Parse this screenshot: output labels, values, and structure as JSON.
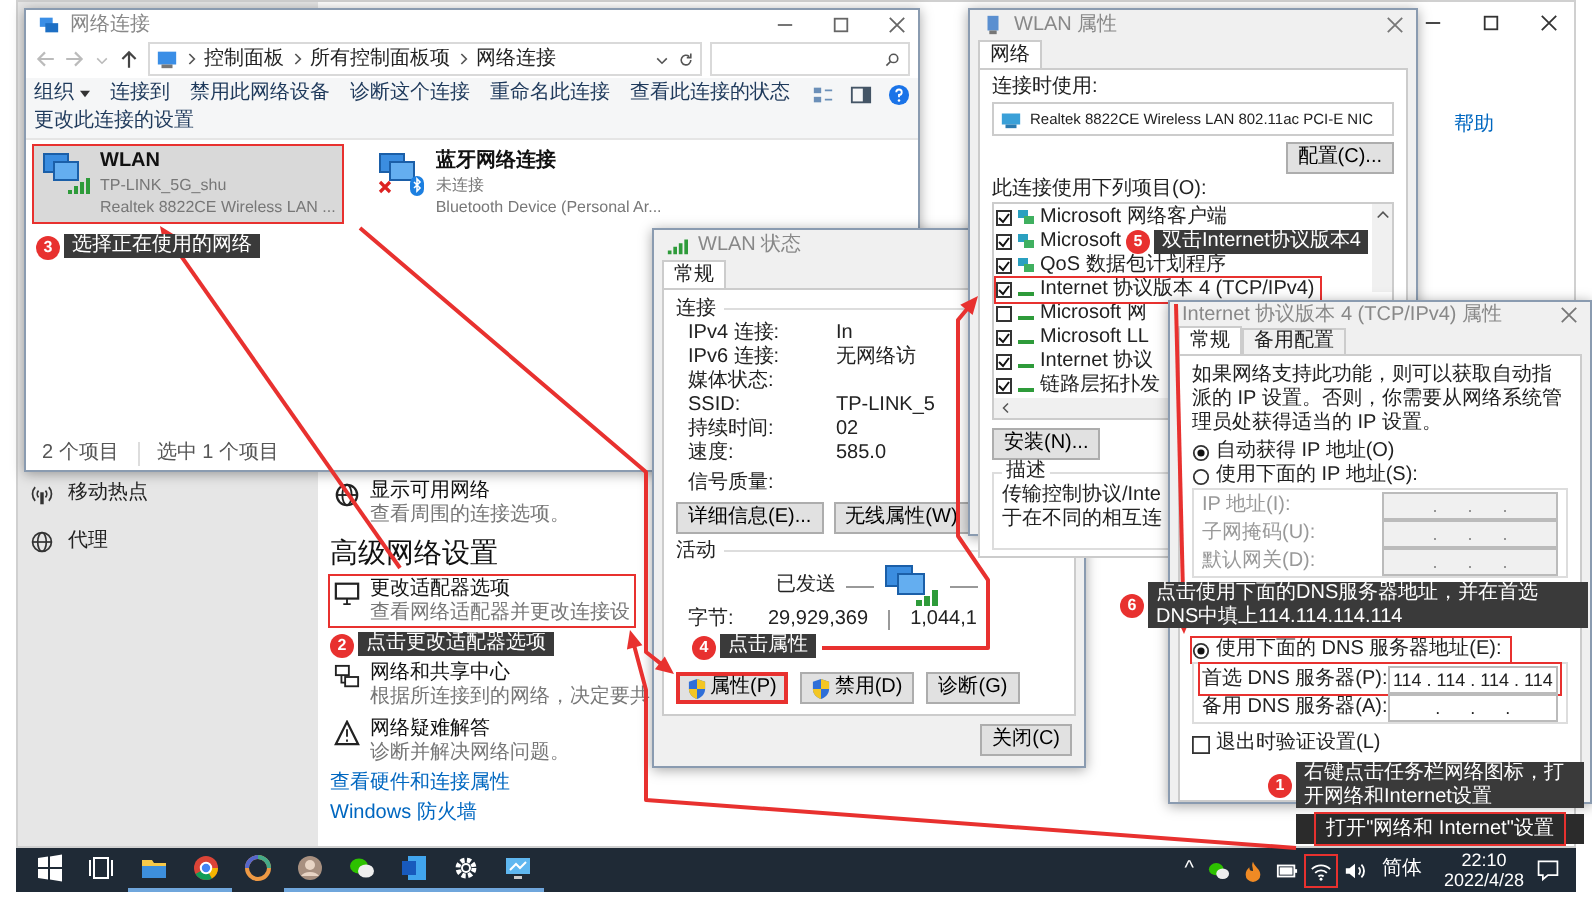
{
  "settings_window": {
    "help_link": "帮助",
    "nav": [
      {
        "label": "移动热点"
      },
      {
        "label": "代理"
      }
    ],
    "show_networks": {
      "title": "显示可用网络",
      "description": "查看周围的连接选项。"
    },
    "heading": "高级网络设置",
    "options": [
      {
        "title": "更改适配器选项",
        "description": "查看网络适配器并更改连接设",
        "highlighted": true
      },
      {
        "title": "网络和共享中心",
        "description": "根据所连接到的网络，决定要共",
        "highlighted": false
      },
      {
        "title": "网络疑难解答",
        "description": "诊断并解决网络问题。",
        "highlighted": false
      }
    ],
    "links": [
      "查看硬件和连接属性",
      "Windows 防火墙"
    ]
  },
  "explorer": {
    "title": "网络连接",
    "breadcrumb": [
      "控制面板",
      "所有控制面板项",
      "网络连接"
    ],
    "toolbar": [
      {
        "label": "组织",
        "menu": true
      },
      {
        "label": "连接到",
        "menu": false
      },
      {
        "label": "禁用此网络设备",
        "menu": false
      },
      {
        "label": "诊断这个连接",
        "menu": false
      },
      {
        "label": "重命名此连接",
        "menu": false
      },
      {
        "label": "查看此连接的状态",
        "menu": false
      },
      {
        "label": "更改此连接的设置",
        "menu": false
      }
    ],
    "connections": [
      {
        "name": "WLAN",
        "status": "TP-LINK_5G_shu",
        "device": "Realtek 8822CE Wireless LAN ...",
        "kind": "wifi",
        "selected": true,
        "highlighted": true
      },
      {
        "name": "蓝牙网络连接",
        "status": "未连接",
        "device": "Bluetooth Device (Personal Ar...",
        "kind": "bluetooth",
        "selected": false,
        "highlighted": false
      }
    ],
    "status_bar": [
      "2 个项目",
      "选中 1 个项目"
    ]
  },
  "status_window": {
    "title": "WLAN 状态",
    "tab": "常规",
    "connection_label": "连接",
    "rows": [
      {
        "label": "IPv4 连接:",
        "value": "In"
      },
      {
        "label": "IPv6 连接:",
        "value": "无网络访"
      },
      {
        "label": "媒体状态:"
      },
      {
        "label": "SSID:",
        "value": "TP-LINK_5"
      },
      {
        "label": "持续时间:",
        "value": "02"
      },
      {
        "label": "速度:",
        "value": "585.0"
      }
    ],
    "signal_label": "信号质量:",
    "detail_buttons": [
      "详细信息(E)...",
      "无线属性(W)"
    ],
    "activity_label": "活动",
    "sent_label": "已发送",
    "bytes_label": "字节:",
    "bytes_sent": "29,929,369",
    "bytes_received": "1,044,1",
    "buttons": [
      {
        "label": "属性(P)",
        "shield": true,
        "highlighted": true
      },
      {
        "label": "禁用(D)",
        "shield": true,
        "highlighted": false
      },
      {
        "label": "诊断(G)",
        "shield": false,
        "highlighted": false
      }
    ],
    "close_button": "关闭(C)"
  },
  "properties_window": {
    "title": "WLAN 属性",
    "tab": "网络",
    "connect_using_label": "连接时使用:",
    "adapter": "Realtek 8822CE Wireless LAN 802.11ac PCI-E NIC",
    "configure_button": "配置(C)...",
    "items_label": "此连接使用下列项目(O):",
    "items": [
      {
        "label": "Microsoft 网络客户端",
        "kind": "client",
        "checked": true,
        "highlighted": false
      },
      {
        "label": "Microsoft",
        "kind": "client",
        "checked": true,
        "highlighted": false
      },
      {
        "label": "QoS 数据包计划程序",
        "kind": "client",
        "checked": true,
        "highlighted": false
      },
      {
        "label": "Internet 协议版本 4 (TCP/IPv4)",
        "kind": "protocol",
        "checked": true,
        "highlighted": true
      },
      {
        "label": "Microsoft 网",
        "kind": "protocol",
        "checked": false,
        "highlighted": false
      },
      {
        "label": "Microsoft LL",
        "kind": "protocol",
        "checked": true,
        "highlighted": false
      },
      {
        "label": "Internet 协议",
        "kind": "protocol",
        "checked": true,
        "highlighted": false
      },
      {
        "label": "链路层拓扑发",
        "kind": "protocol",
        "checked": true,
        "highlighted": false
      }
    ],
    "install_button": "安装(N)...",
    "description_label": "描述",
    "description_lines": [
      "传输控制协议/Inte",
      "于在不同的相互连"
    ]
  },
  "ipv4_window": {
    "title": "Internet 协议版本 4 (TCP/IPv4) 属性",
    "tabs": [
      {
        "label": "常规",
        "selected": true
      },
      {
        "label": "备用配置",
        "selected": false
      }
    ],
    "description": "如果网络支持此功能，则可以获取自动指派的 IP 设置。否则，你需要从网络系统管理员处获得适当的 IP 设置。",
    "ip_options": [
      {
        "label": "自动获得 IP 地址(O)",
        "selected": true
      },
      {
        "label": "使用下面的 IP 地址(S):",
        "selected": false
      }
    ],
    "ip_fields": [
      {
        "label": "IP 地址(I):",
        "value": ".      .      .",
        "disabled": true
      },
      {
        "label": "子网掩码(U):",
        "value": ".      .      .",
        "disabled": true
      },
      {
        "label": "默认网关(D):",
        "value": ".      .      .",
        "disabled": true
      }
    ],
    "dns_option": {
      "label": "使用下面的 DNS 服务器地址(E):",
      "selected": true,
      "highlighted": true
    },
    "dns_fields": [
      {
        "label": "首选 DNS 服务器(P):",
        "value": "114 . 114 . 114 . 114",
        "highlighted": true
      },
      {
        "label": "备用 DNS 服务器(A):",
        "value": ".      .      .",
        "highlighted": false
      }
    ],
    "validate": {
      "label": "退出时验证设置(L)",
      "checked": false
    }
  },
  "taskbar": {
    "apps": [
      {
        "kind": "start",
        "running": false
      },
      {
        "kind": "taskview",
        "running": false
      },
      {
        "kind": "folder",
        "running": true
      },
      {
        "kind": "chrome",
        "running": true
      },
      {
        "kind": "colorwheel",
        "running": false
      },
      {
        "kind": "avatar",
        "running": true
      },
      {
        "kind": "wechat",
        "running": true
      },
      {
        "kind": "word",
        "running": true
      },
      {
        "kind": "gear",
        "running": true
      },
      {
        "kind": "remote",
        "running": true
      }
    ],
    "overflow": "^",
    "tray": [
      {
        "kind": "wechat",
        "highlighted": false
      },
      {
        "kind": "flame",
        "highlighted": false
      },
      {
        "kind": "battery",
        "highlighted": false
      },
      {
        "kind": "network",
        "highlighted": true
      },
      {
        "kind": "speaker",
        "highlighted": false
      }
    ],
    "language": "简体",
    "time": "22:10",
    "date": "2022/4/28"
  },
  "context_menu": {
    "items": [
      {
        "label": "打开\"网络和 Internet\"设置",
        "highlighted": true
      }
    ]
  },
  "annotations": [
    {
      "number": "1",
      "text": "右键点击任务栏网络图标，打开网络和Internet设置"
    },
    {
      "number": "2",
      "text": "点击更改适配器选项"
    },
    {
      "number": "3",
      "text": "选择正在使用的网络"
    },
    {
      "number": "4",
      "text": "点击属性"
    },
    {
      "number": "5",
      "text": "双击Internet协议版本4"
    },
    {
      "number": "6",
      "text": "点击使用下面的DNS服务器地址，并在首选DNS中填上114.114.114.114"
    }
  ]
}
